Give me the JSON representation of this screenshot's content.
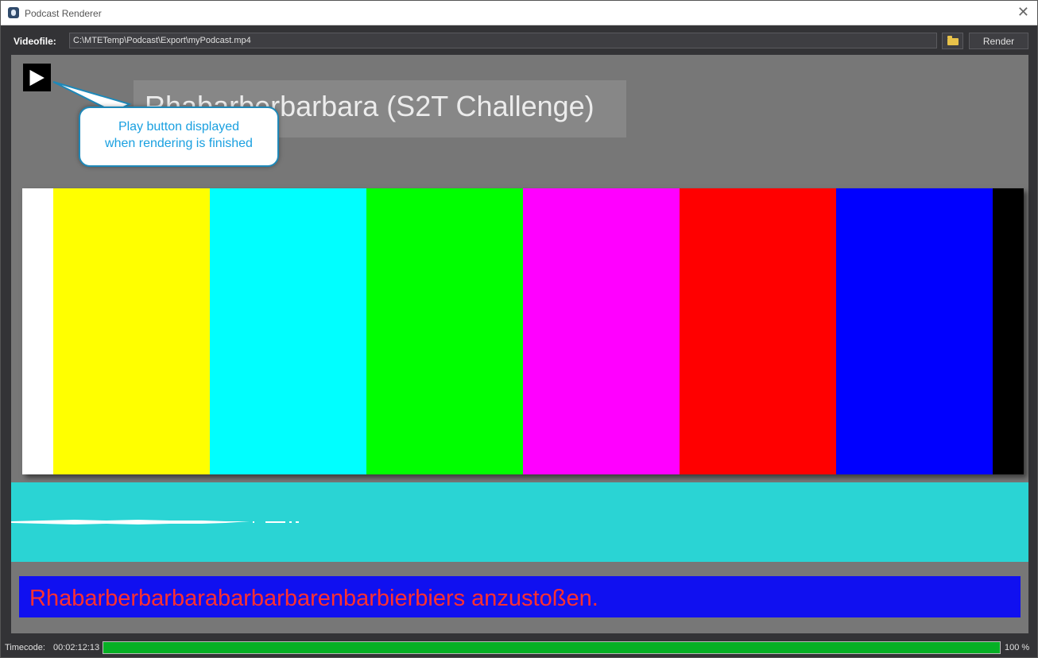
{
  "window": {
    "title": "Podcast Renderer",
    "close_glyph": "✕"
  },
  "toolbar": {
    "videofile_label": "Videofile:",
    "videofile_path": "C:\\MTETemp\\Podcast\\Export\\myPodcast.mp4",
    "browse_icon": "folder-icon",
    "render_label": "Render"
  },
  "preview": {
    "play_icon": "play-icon",
    "video_title": "Rhabarberbarbara (S2T Challenge)",
    "callout_line1": "Play button displayed",
    "callout_line2": "when rendering is finished",
    "color_bars": [
      "#ffffff",
      "#ffff00",
      "#00ffff",
      "#00ff00",
      "#ff00ff",
      "#ff0000",
      "#0000ff",
      "#000000"
    ],
    "waveform_color": "#2ad4d4"
  },
  "subtitle": {
    "text": "Rhabarberbarbarabarbarbarenbarbierbiers anzustoßen.",
    "text_color": "#ff3030",
    "background_color": "#1010f0"
  },
  "status": {
    "timecode_label": "Timecode:",
    "timecode_value": "00:02:12:13",
    "progress_percent": 100,
    "progress_text": "100 %",
    "progress_color": "#06b025"
  }
}
